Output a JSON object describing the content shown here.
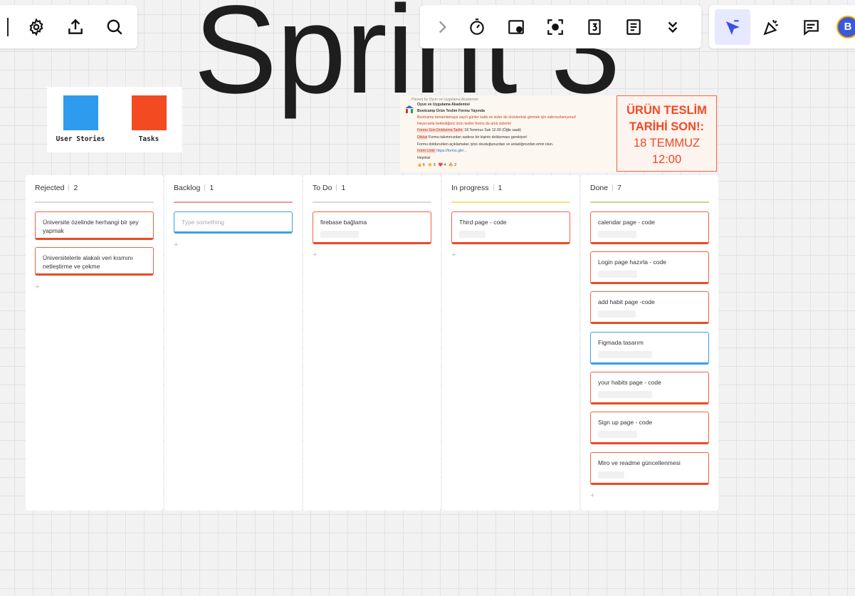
{
  "board_title": "Sprint 3",
  "toolbar_left": {
    "icons": [
      "settings-icon",
      "upload-icon",
      "search-icon"
    ]
  },
  "toolbar_mid": {
    "icons": [
      "chevron-right-icon",
      "timer-icon",
      "embed-icon",
      "focus-icon",
      "countdown-icon",
      "notes-icon",
      "chevron-double-down-icon"
    ]
  },
  "toolbar_right": {
    "icons": [
      "select-cursor-icon",
      "celebrate-icon",
      "comment-icon"
    ],
    "avatar_initial": "B"
  },
  "legend": {
    "items": [
      {
        "label": "User Stories",
        "color": "#2f9bef"
      },
      {
        "label": "Tasks",
        "color": "#f34a22"
      }
    ]
  },
  "announcement": {
    "pinned": "Pinned by Oyun ve Uygulama Akademisi",
    "sender": "Oyun ve Uygulama Akademisi",
    "headline": "Bootcamp Ürün Teslim Formu Yayında",
    "line1": "Bootcamp tamamlamaya sayılı günler kaldı ve sizler de ürünlerinizi görmek için sabırsızlanıyoruz!",
    "line2": "Heyecanla beklediğiniz ürün teslim formu da artık sizlerle!",
    "line3_tag": "Formu Son Doldurma Tarihi:",
    "line3": "18 Temmuz Salı 12.00 (Öğle saati)",
    "line4_tag": "Dikkat",
    "line4": "Formu takımınızdan sadece bir kişinin doldurması gerekiyor!",
    "line5": "Formu doldururken açıklamaları iyice okuduğunuzdan ve anladığınızdan emin olun.",
    "line6_tag": "Form Linki:",
    "line6": "https://forms.gle/...",
    "line7": "Hepinizi",
    "reactions": [
      "👍 6",
      "👏 3",
      "❤️ 4",
      "🔥 2"
    ]
  },
  "deadline": {
    "line1": "ÜRÜN TESLİM",
    "line2": "TARİHİ SON!:",
    "line3": "18 TEMMUZ",
    "line4": "12:00"
  },
  "columns": [
    {
      "title": "Rejected",
      "count": "2",
      "line_color": "#d9d9d9",
      "cards": [
        {
          "text": "Üniversite özelinde herhangi bir şey yapmak",
          "color": "orange"
        },
        {
          "text": "Üniversitelerle alakalı veri kısmını netleştirme ve çekme",
          "color": "orange"
        }
      ]
    },
    {
      "title": "Backlog",
      "count": "1",
      "line_color": "#f49a8c",
      "cards": [
        {
          "placeholder": "Type something",
          "color": "blue"
        }
      ]
    },
    {
      "title": "To Do",
      "count": "1",
      "line_color": "#d9d9d9",
      "cards": [
        {
          "text": "firebase bağlama",
          "color": "orange"
        }
      ]
    },
    {
      "title": "In progress",
      "count": "1",
      "line_color": "#f6e27a",
      "cards": [
        {
          "text": "Third page - code",
          "color": "orange"
        }
      ]
    },
    {
      "title": "Done",
      "count": "7",
      "line_color": "#b9dc8a",
      "cards": [
        {
          "text": "calendar page - code",
          "color": "orange"
        },
        {
          "text": "Login page hazırla - code",
          "color": "orange"
        },
        {
          "text": "add habit page -code",
          "color": "orange"
        },
        {
          "text": "Figmada tasarım",
          "color": "blue"
        },
        {
          "text": "your habits page - code",
          "color": "orange"
        },
        {
          "text": "Sign up page - code",
          "color": "orange"
        },
        {
          "text": "Miro ve readme güncellenmesi",
          "color": "orange"
        }
      ]
    }
  ],
  "add_symbol": "+"
}
